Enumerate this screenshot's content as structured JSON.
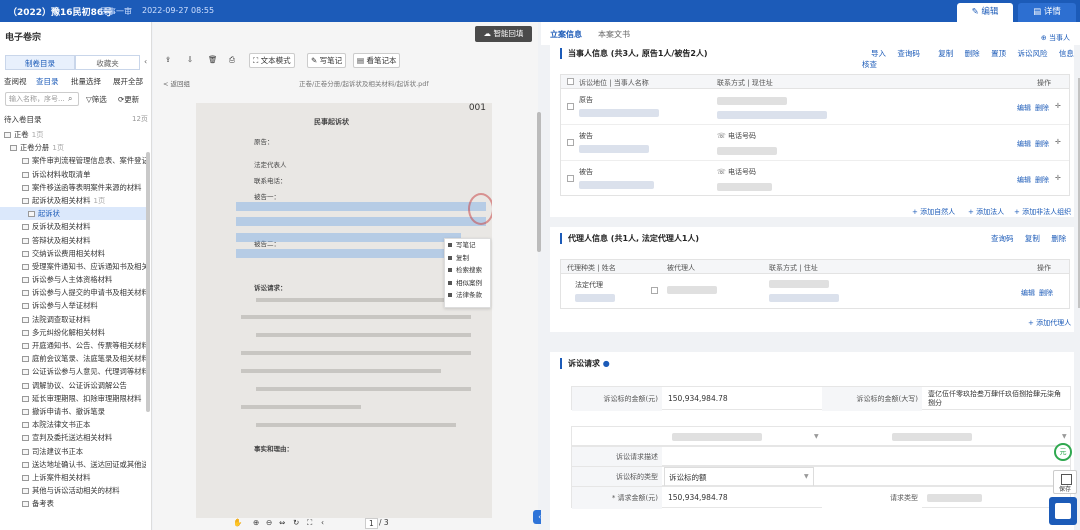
{
  "header": {
    "case_no": "（2022）豫16民初86号",
    "procedure": "民事一审",
    "date": "2022-09-27 08:55",
    "edit_tab": "编辑",
    "detail_tab": "详情"
  },
  "left": {
    "title": "电子卷宗",
    "seg_catalog": "制卷目录",
    "seg_fav": "收藏夹",
    "nav": [
      "查阅视",
      "查目录",
      "批量选择",
      "展开全部"
    ],
    "search_placeholder": "输入名称，序号...",
    "filter": "筛选",
    "refresh": "更新",
    "pending": "待入卷目录",
    "pending_count": "12页",
    "tree": [
      {
        "label": "正卷",
        "level": 0,
        "count": "1页"
      },
      {
        "label": "正卷分册",
        "level": 1,
        "count": "1页"
      },
      {
        "label": "案件审判流程管理信息表、案件登记...",
        "level": 2
      },
      {
        "label": "诉讼材料收取清单",
        "level": 2
      },
      {
        "label": "案件移送函等表明案件来源的材料",
        "level": 2
      },
      {
        "label": "起诉状及相关材料",
        "level": 2,
        "count": "1页"
      },
      {
        "label": "起诉状",
        "level": 3,
        "selected": true
      },
      {
        "label": "反诉状及相关材料",
        "level": 2
      },
      {
        "label": "答辩状及相关材料",
        "level": 2
      },
      {
        "label": "交纳诉讼费用相关材料",
        "level": 2
      },
      {
        "label": "受理案件通知书、应诉通知书及相关...",
        "level": 2
      },
      {
        "label": "诉讼参与人主体资格材料",
        "level": 2
      },
      {
        "label": "诉讼参与人提交的申请书及相关材料",
        "level": 2
      },
      {
        "label": "诉讼参与人举证材料",
        "level": 2
      },
      {
        "label": "法院调查取证材料",
        "level": 2
      },
      {
        "label": "多元纠纷化解相关材料",
        "level": 2
      },
      {
        "label": "开庭通知书、公告、传票等相关材料",
        "level": 2
      },
      {
        "label": "庭前会议笔录、法庭笔录及相关材料",
        "level": 2
      },
      {
        "label": "公证诉讼参与人意见、代理词等材料",
        "level": 2
      },
      {
        "label": "调解协议、公证诉讼调解公告",
        "level": 2
      },
      {
        "label": "延长审理期限、扣除审理期限材料",
        "level": 2
      },
      {
        "label": "撤诉申请书、撤诉笔录",
        "level": 2
      },
      {
        "label": "本院法律文书正本",
        "level": 2
      },
      {
        "label": "宣判及委托送达相关材料",
        "level": 2
      },
      {
        "label": "司法建议书正本",
        "level": 2
      },
      {
        "label": "送达地址确认书、送达回证或其他送...",
        "level": 2
      },
      {
        "label": "上诉案件相关材料",
        "level": 2
      },
      {
        "label": "其他与诉讼活动相关的材料",
        "level": 2
      },
      {
        "label": "备考表",
        "level": 2
      }
    ]
  },
  "viewer": {
    "toolbar": [
      "文本模式",
      "写笔记",
      "看笔记本"
    ],
    "ai_button": "智能回填",
    "back": "< 返回组",
    "path": "正卷/正卷分册/起诉状及相关材料/起诉状.pdf",
    "page_no": "001",
    "doc_title": "民事起诉状",
    "doc_lines": [
      "原告：",
      "法定代表人",
      "联系电话：",
      "被告一：",
      "被告二：",
      "诉讼请求：",
      "事实和理由："
    ],
    "context_menu": [
      "写笔记",
      "复制",
      "检索搜索",
      "相似案例",
      "法律条款"
    ],
    "pager": {
      "current": "1",
      "total": "/ 3"
    }
  },
  "right": {
    "tab_info": "立案信息",
    "tab_doc": "本案文书",
    "add_party": "当事人",
    "parties": {
      "title": "当事人信息 (共3人, 原告1人/被告2人)",
      "actions": [
        "导入",
        "查询码",
        "复制",
        "删除",
        "置顶",
        "诉讼风险",
        "信息核查"
      ],
      "headers": [
        "诉讼地位 | 当事人名称",
        "联系方式 | 现住址",
        "操作"
      ],
      "rows": [
        {
          "role": "原告",
          "contact": ""
        },
        {
          "role": "被告",
          "contact": "电话号码"
        },
        {
          "role": "被告",
          "contact": "电话号码"
        }
      ],
      "row_ops": [
        "编辑",
        "删除"
      ],
      "add_links": [
        "+ 添加自然人",
        "+ 添加法人",
        "+ 添加非法人组织"
      ]
    },
    "agents": {
      "title": "代理人信息 (共1人, 法定代理人1人)",
      "actions": [
        "查询码",
        "复制",
        "删除"
      ],
      "headers": [
        "代理种类 | 姓名",
        "被代理人",
        "联系方式 | 住址",
        "操作"
      ],
      "rows": [
        {
          "type": "法定代理"
        }
      ],
      "row_ops": [
        "编辑",
        "删除"
      ],
      "add_link": "+ 添加代理人"
    },
    "claims": {
      "title": "诉讼请求",
      "amount_label": "诉讼标的金额(元)",
      "amount_value": "150,934,984.78",
      "amount_upper_label": "诉讼标的金额(大写)",
      "amount_upper_value": "壹亿伍仟零玖拾叁万肆仟玖佰捌拾肆元柒角捌分",
      "desc_label": "诉讼请求描述",
      "type_label": "诉讼标的类型",
      "type_value": "诉讼标的额",
      "req_amount_label": "* 请求金额(元)",
      "req_amount_value": "150,934,984.78",
      "req_type_label": "请求类型"
    },
    "save_label": "保存"
  }
}
